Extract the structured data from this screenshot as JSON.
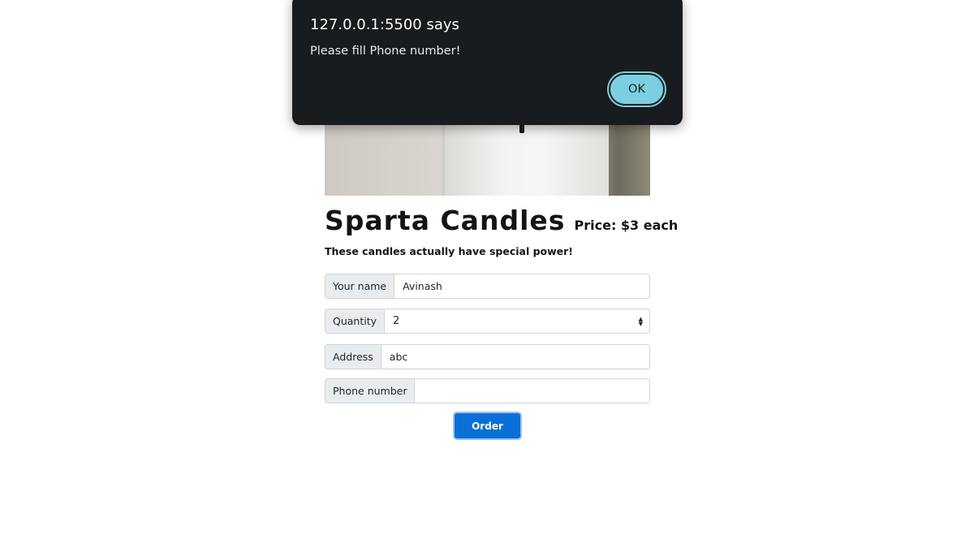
{
  "dialog": {
    "title": "127.0.0.1:5500 says",
    "message": "Please fill Phone number!",
    "ok_label": "OK"
  },
  "page": {
    "title": "Sparta Candles",
    "price": "Price: $3 each",
    "tagline": "These candles actually have special power!"
  },
  "form": {
    "name": {
      "label": "Your name",
      "value": "Avinash"
    },
    "quantity": {
      "label": "Quantity",
      "value": "2"
    },
    "address": {
      "label": "Address",
      "value": "abc"
    },
    "phone": {
      "label": "Phone number",
      "value": ""
    },
    "order_label": "Order"
  },
  "colors": {
    "dialog_bg": "#181c1e",
    "ok_button": "#7ccfe0",
    "order_button": "#0b6fd8"
  }
}
